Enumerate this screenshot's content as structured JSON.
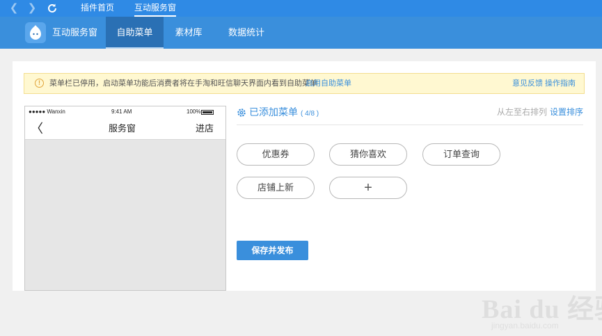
{
  "browser": {
    "back": "❮",
    "forward": "❯",
    "tabs": [
      "插件首页",
      "互动服务窗"
    ]
  },
  "header": {
    "app_name": "互动服务窗",
    "tabs": [
      {
        "label": "自助菜单",
        "active": true
      },
      {
        "label": "素材库",
        "active": false
      },
      {
        "label": "数据统计",
        "active": false
      }
    ]
  },
  "notice": {
    "icon": "!",
    "text": "菜单栏已停用，启动菜单功能后消费者将在手淘和旺信聊天界面内看到自助菜单",
    "enable_link": "启用自助菜单",
    "feedback_link": "意见反馈",
    "guide_link": "操作指南"
  },
  "phone": {
    "carrier": "●●●●● Wanxin",
    "time": "9:41 AM",
    "battery": "100%",
    "back": "〈",
    "title": "服务窗",
    "shop": "进店"
  },
  "menu": {
    "title": "已添加菜单",
    "count": "( 4/8 )",
    "sort_hint": "从左至右排列",
    "sort_link": "设置排序",
    "items": [
      "优惠券",
      "猜你喜欢",
      "订单查询",
      "店铺上新"
    ],
    "add": "+",
    "publish": "保存并发布"
  },
  "watermark": {
    "title": "Bai du 经验",
    "sub": "jingyan.baidu.com"
  },
  "colors": {
    "topbar": "#2f8ae5",
    "header": "#3a8fdc",
    "header_active": "#2a70b4",
    "accent": "#3a8fdc"
  }
}
